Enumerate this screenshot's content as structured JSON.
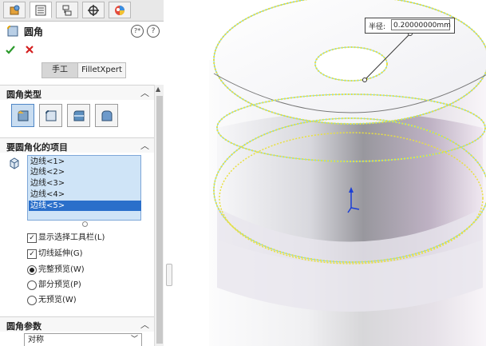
{
  "toolbar": {
    "tabs": [
      {
        "icon": "feature-manager-icon"
      },
      {
        "icon": "property-manager-icon"
      },
      {
        "icon": "configuration-manager-icon"
      },
      {
        "icon": "dimxpert-icon"
      },
      {
        "icon": "display-manager-icon"
      }
    ]
  },
  "feature": {
    "title": "圆角",
    "icon": "fillet-icon"
  },
  "modes": [
    "手工",
    "FilletXpert"
  ],
  "fillet_type": {
    "label": "圆角类型",
    "selected_index": 0,
    "options": [
      "constant-size-fillet-icon",
      "variable-size-fillet-icon",
      "face-fillet-icon",
      "full-round-fillet-icon"
    ]
  },
  "items": {
    "label": "要圆角化的项目",
    "list": [
      "边线<1>",
      "边线<2>",
      "边线<3>",
      "边线<4>",
      "边线<5>"
    ],
    "selected_index": 4
  },
  "options": {
    "show_toolbar": "显示选择工具栏(L)",
    "tangent": "切线延伸(G)",
    "full_preview": "完整预览(W)",
    "partial_preview": "部分预览(P)",
    "no_preview": "无预览(W)"
  },
  "params": {
    "label": "圆角参数",
    "value": "对称"
  },
  "callout": {
    "label": "半径:",
    "value": "0.20000000mm"
  },
  "colors": {
    "accent": "#2a6fca",
    "ok": "#2b9a2b",
    "cancel": "#d42020",
    "edge_highlight": "#f0e446"
  }
}
